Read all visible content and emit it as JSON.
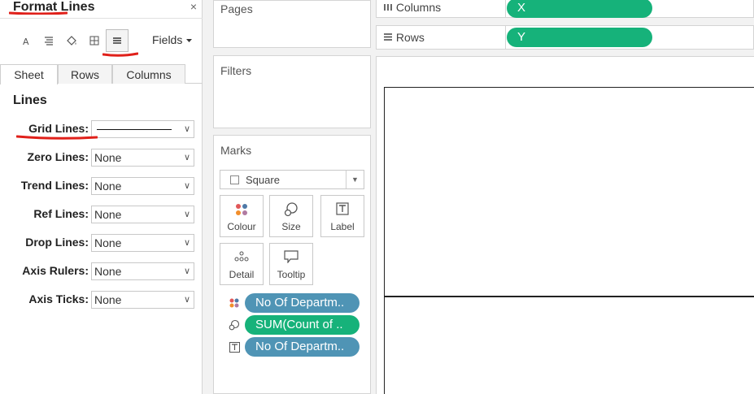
{
  "format_pane": {
    "title": "Format Lines",
    "close": "×",
    "fields_label": "Fields",
    "tabs": [
      "Sheet",
      "Rows",
      "Columns"
    ],
    "section": "Lines",
    "options": [
      {
        "label": "Grid Lines:",
        "value": ""
      },
      {
        "label": "Zero Lines:",
        "value": "None"
      },
      {
        "label": "Trend Lines:",
        "value": "None"
      },
      {
        "label": "Ref Lines:",
        "value": "None"
      },
      {
        "label": "Drop Lines:",
        "value": "None"
      },
      {
        "label": "Axis Rulers:",
        "value": "None"
      },
      {
        "label": "Axis Ticks:",
        "value": "None"
      }
    ]
  },
  "cards": {
    "pages": "Pages",
    "filters": "Filters",
    "marks": "Marks"
  },
  "marks": {
    "type": "Square",
    "buttons": [
      "Colour",
      "Size",
      "Label",
      "Detail",
      "Tooltip"
    ],
    "pills": [
      "No Of Departm..",
      "SUM(Count of ..",
      "No Of Departm.."
    ]
  },
  "shelves": {
    "columns_label": "Columns",
    "rows_label": "Rows",
    "columns_pill": "X",
    "rows_pill": "Y"
  },
  "colors": {
    "pill_green": "#16b27a",
    "pill_blue": "#4f94b5",
    "annotation_red": "#e0201a"
  }
}
